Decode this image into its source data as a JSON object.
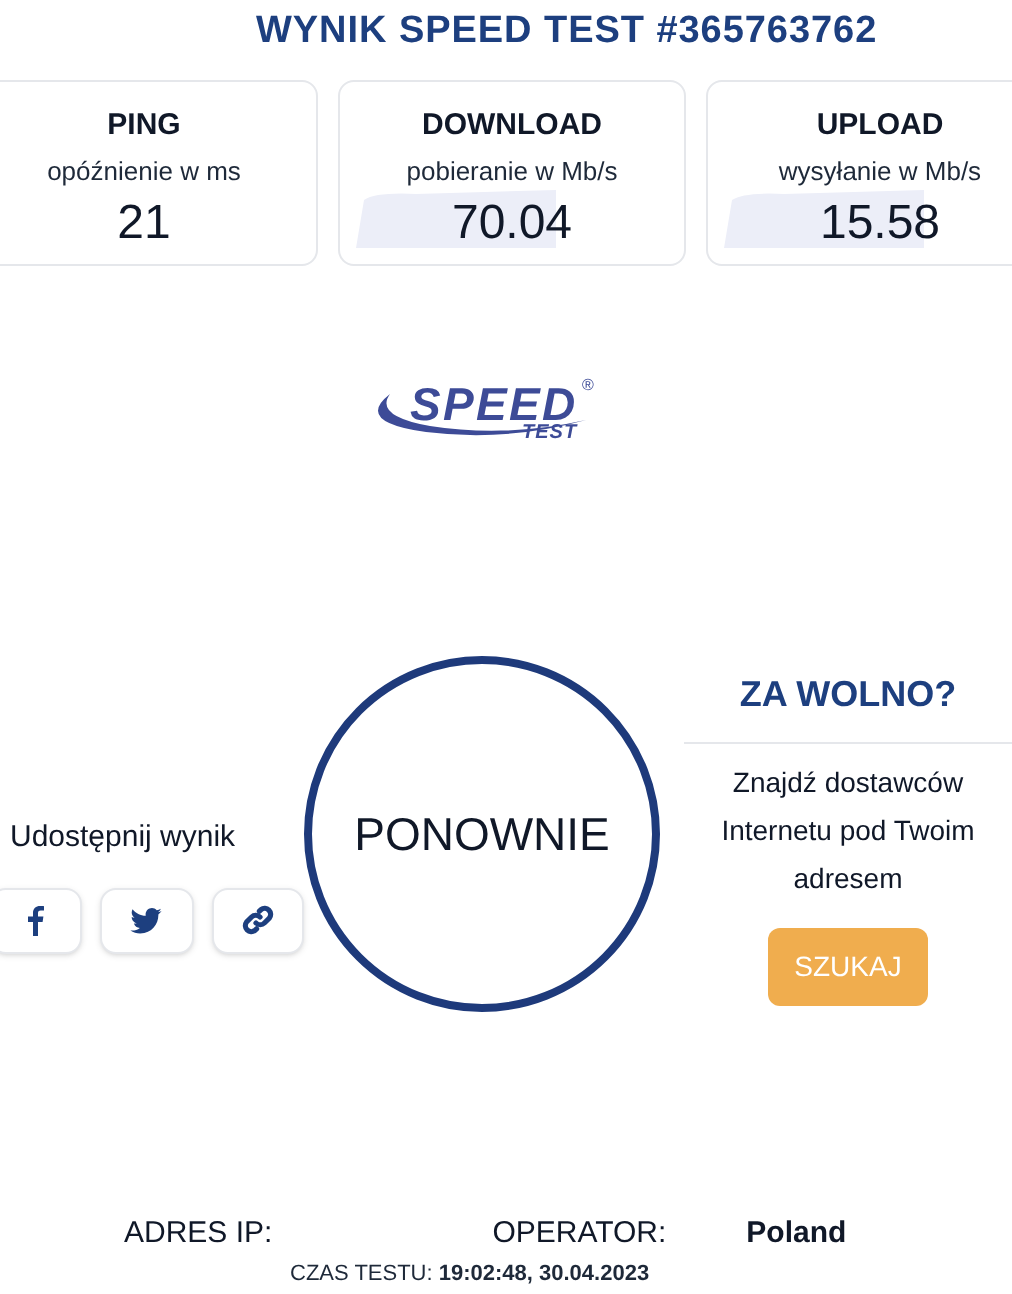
{
  "title": "WYNIK SPEED TEST #365763762",
  "metrics": [
    {
      "label": "PING",
      "sublabel": "opóźnienie w ms",
      "value": "21",
      "kind": "plain"
    },
    {
      "label": "DOWNLOAD",
      "sublabel": "pobieranie w Mb/s",
      "value": "70.04",
      "kind": "graph"
    },
    {
      "label": "UPLOAD",
      "sublabel": "wysyłanie w Mb/s",
      "value": "15.58",
      "kind": "graph"
    }
  ],
  "logo": {
    "word": "SPEED",
    "subword": "TEST",
    "mark": "®"
  },
  "share": {
    "label": "Udostępnij wynik",
    "buttons": [
      {
        "kind": "facebook"
      },
      {
        "kind": "twitter"
      },
      {
        "kind": "link"
      }
    ]
  },
  "retry_button": "PONOWNIE",
  "too_slow": {
    "title": "ZA WOLNO?",
    "text": "Znajdź dostawców Internetu pod Twoim adresem",
    "button": "SZUKAJ"
  },
  "footer": {
    "ip_label": "ADRES IP:",
    "operator_label": "OPERATOR:",
    "operator_value": "Poland",
    "time": "CZAS TESTU: **19:02:48, 30.04.2023**"
  }
}
